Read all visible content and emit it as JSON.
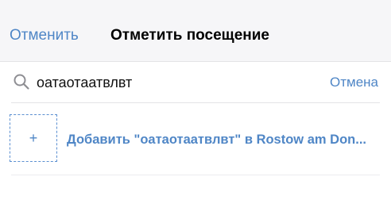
{
  "header": {
    "cancel_label": "Отменить",
    "title": "Отметить посещение"
  },
  "search": {
    "icon": "search-icon",
    "query": "оатаотаатвлвт",
    "cancel_label": "Отмена"
  },
  "results": {
    "add_place": {
      "icon": "plus-icon",
      "plus_glyph": "+",
      "label": "Добавить \"оатаотаатвлвт\" в Rostow am Don..."
    }
  },
  "colors": {
    "accent": "#4f86c6",
    "header_background": "#f6f6f8",
    "divider": "#e3e3e6"
  }
}
